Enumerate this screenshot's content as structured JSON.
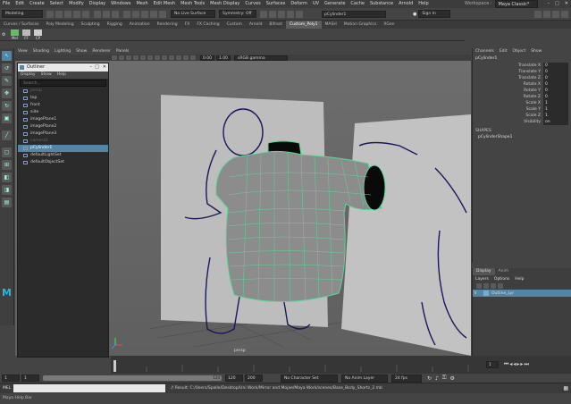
{
  "menubar": {
    "items": [
      "File",
      "Edit",
      "Create",
      "Select",
      "Modify",
      "Display",
      "Windows",
      "Mesh",
      "Edit Mesh",
      "Mesh Tools",
      "Mesh Display",
      "Curves",
      "Surfaces",
      "Deform",
      "UV",
      "Generate",
      "Cache",
      "Substance",
      "Arnold",
      "Help"
    ],
    "workspace_label": "Workspace :",
    "workspace_value": "Maya Classic*"
  },
  "statusline": {
    "mode": "Modeling",
    "live_surface": "No Live Surface",
    "symmetry": "Symmetry: Off",
    "object_name": "pCylinder1",
    "sign_in": "Sign In"
  },
  "shelf_tabs": [
    "Curves / Surfaces",
    "Poly Modeling",
    "Sculpting",
    "Rigging",
    "Animation",
    "Rendering",
    "FX",
    "FX Caching",
    "Custom",
    "Arnold",
    "Bifrost",
    "Custom_Poly1",
    "MASH",
    "Motion Graphics",
    "XGen"
  ],
  "shelf_active": "Custom_Poly1",
  "shelf_labels": [
    "Mel",
    "FF",
    "CP"
  ],
  "panel": {
    "menus": [
      "View",
      "Shading",
      "Lighting",
      "Show",
      "Renderer",
      "Panels"
    ],
    "field1": "0.00",
    "field2": "1.00",
    "colorspace": "sRGB gamma",
    "camera_label": "persp"
  },
  "outliner": {
    "title": "Outliner",
    "menus": [
      "Display",
      "Show",
      "Help"
    ],
    "search_placeholder": "Search...",
    "items": [
      {
        "label": "persp",
        "state": "dim"
      },
      {
        "label": "top",
        "state": "normal"
      },
      {
        "label": "front",
        "state": "normal"
      },
      {
        "label": "side",
        "state": "normal"
      },
      {
        "label": "imagePlane1",
        "state": "normal"
      },
      {
        "label": "imagePlane2",
        "state": "normal"
      },
      {
        "label": "imagePlane3",
        "state": "normal"
      },
      {
        "label": "camera1",
        "state": "dim"
      },
      {
        "label": "pCylinder1",
        "state": "selected"
      },
      {
        "label": "defaultLightSet",
        "state": "normal"
      },
      {
        "label": "defaultObjectSet",
        "state": "normal"
      }
    ]
  },
  "channelbox": {
    "menus": [
      "Channels",
      "Edit",
      "Object",
      "Show"
    ],
    "object": "pCylinder1",
    "attributes": [
      {
        "label": "Translate X",
        "value": "0"
      },
      {
        "label": "Translate Y",
        "value": "0"
      },
      {
        "label": "Translate Z",
        "value": "0"
      },
      {
        "label": "Rotate X",
        "value": "0"
      },
      {
        "label": "Rotate Y",
        "value": "0"
      },
      {
        "label": "Rotate Z",
        "value": "0"
      },
      {
        "label": "Scale X",
        "value": "1"
      },
      {
        "label": "Scale Y",
        "value": "1"
      },
      {
        "label": "Scale Z",
        "value": "1"
      },
      {
        "label": "Visibility",
        "value": "on"
      }
    ],
    "shapes_header": "SHAPES",
    "shape_name": "pCylinderShape1"
  },
  "layers": {
    "tabs": [
      "Display",
      "Anim"
    ],
    "menus": [
      "Layers",
      "Options",
      "Help"
    ],
    "layer_name": "Outline_Lyr"
  },
  "timeline": {
    "start": "1",
    "end": "120",
    "current": "1"
  },
  "range": {
    "range_start": "1",
    "range_inner_start": "1",
    "range_inner_end": "120",
    "range_end_a": "120",
    "range_end_b": "200",
    "character_set": "No Character Set",
    "anim_layer": "No Anim Layer",
    "fps": "24 fps"
  },
  "cmdline": {
    "label": "MEL",
    "result": "// Result: C:/Users/Spalle/Desktop/Uni Work/Mirror and Mojae/Maya Work/scenes/Base_Body_Shorts_2.mb"
  },
  "helpline": {
    "text": "Maya Help Bar"
  },
  "colors": {
    "selection": "#5285a6",
    "wire": "#5cd59a",
    "mesh": "#8c8c8c"
  }
}
